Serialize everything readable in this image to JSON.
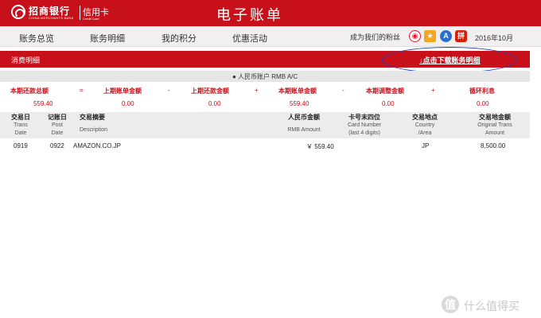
{
  "header": {
    "bank_name": "招商银行",
    "bank_name_en": "CHINA MERCHANTS BANK",
    "card_label": "信用卡",
    "card_label_en": "Credit Card",
    "title": "电子账单",
    "brand_color": "#c8101a"
  },
  "nav": {
    "items": [
      {
        "label": "账务总览"
      },
      {
        "label": "账务明细"
      },
      {
        "label": "我的积分"
      },
      {
        "label": "优惠活动"
      }
    ],
    "fans_label": "成为我们的粉丝",
    "social_icons": [
      "weibo-icon",
      "star-icon",
      "a-icon",
      "pin-icon"
    ],
    "date": "2016年10月"
  },
  "section": {
    "title": "消费明细",
    "download_link": "↓点击下载账务明细"
  },
  "currency": {
    "label": "● 人民币账户 RMB A/C"
  },
  "summary": {
    "labels": [
      "本期还款总额",
      "上期账单金额",
      "上期还款金额",
      "本期账单金额",
      "本期调整金额",
      "循环利息"
    ],
    "operators": [
      "=",
      "-",
      "+",
      "-",
      "+"
    ],
    "values": [
      "559.40",
      "0.00",
      "0.00",
      "559.40",
      "0.00",
      "0.00"
    ]
  },
  "table": {
    "headers": [
      {
        "cn": "交易日",
        "en1": "Trans",
        "en2": "Date"
      },
      {
        "cn": "记账日",
        "en1": "Post",
        "en2": "Date"
      },
      {
        "cn": "交易摘要",
        "en1": "Description",
        "en2": ""
      },
      {
        "cn": "人民币金额",
        "en1": "RMB Amount",
        "en2": ""
      },
      {
        "cn": "卡号末四位",
        "en1": "Card Number",
        "en2": "(last 4 digits)"
      },
      {
        "cn": "交易地点",
        "en1": "Country",
        "en2": "/Area"
      },
      {
        "cn": "交易地金额",
        "en1": "Original Trans",
        "en2": "Amount"
      }
    ],
    "rows": [
      {
        "trans_date": "0919",
        "post_date": "0922",
        "description": "AMAZON.CO.JP",
        "rmb_amount": "￥ 559.40",
        "card_last4": "",
        "country": "JP",
        "original_amount": "8,500.00"
      }
    ]
  },
  "watermark": {
    "icon": "值",
    "text": "什么值得买"
  }
}
